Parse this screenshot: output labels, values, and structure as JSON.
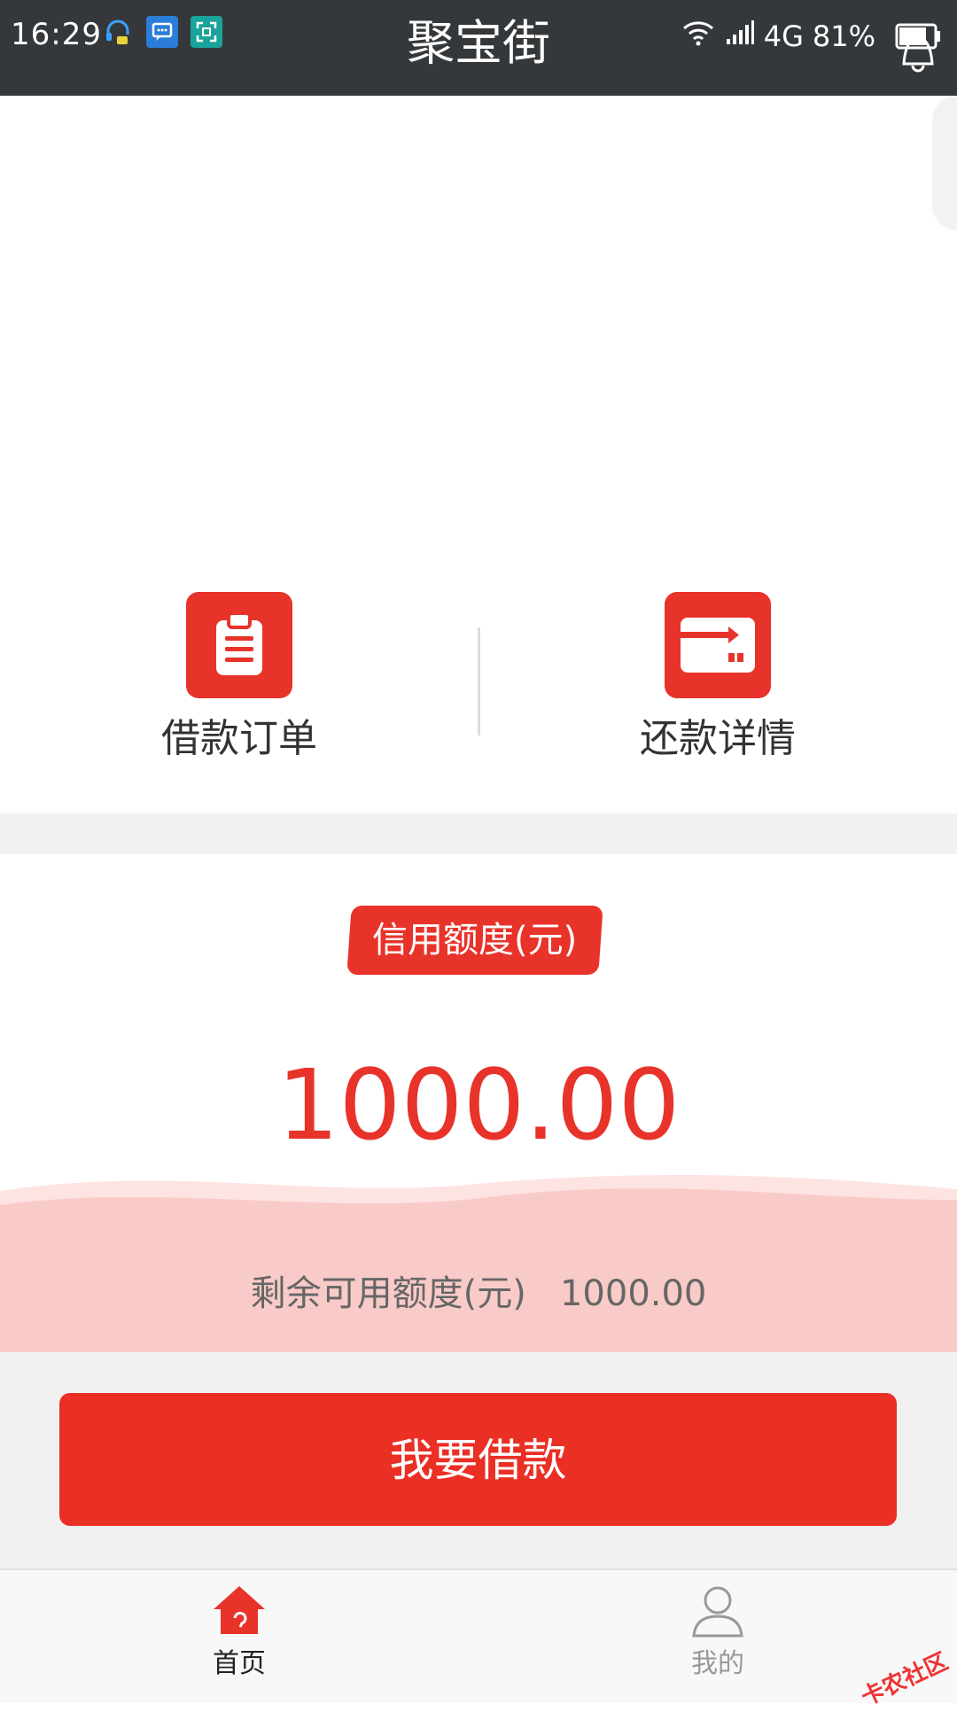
{
  "status_bar": {
    "time": "16:29",
    "network": "4G",
    "battery": "81%"
  },
  "app": {
    "title": "聚宝街"
  },
  "quick_actions": {
    "loan_orders_label": "借款订单",
    "repayment_details_label": "还款详情"
  },
  "credit": {
    "badge_label": "信用额度(元)",
    "amount": "1000.00",
    "remaining_label": "剩余可用额度(元)",
    "remaining_amount": "1000.00"
  },
  "borrow_button_label": "我要借款",
  "tabbar": {
    "home_label": "首页",
    "mine_label": "我的"
  },
  "watermark": "卡农社区",
  "colors": {
    "accent": "#e8332a",
    "status_bar": "#35383b",
    "wave": "#f8c9c6"
  }
}
